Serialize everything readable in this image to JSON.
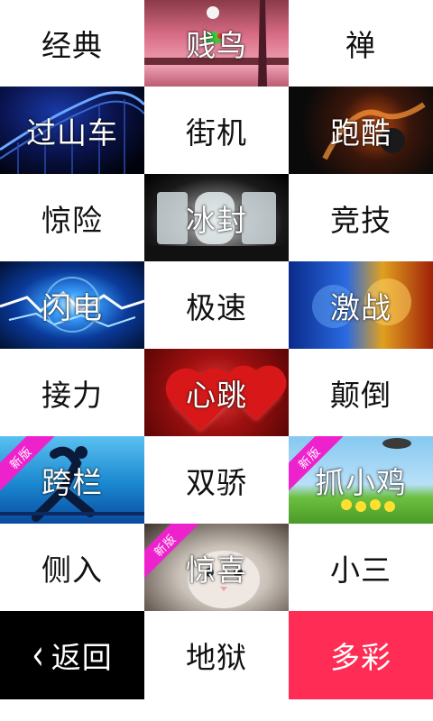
{
  "tiles": [
    {
      "label": "经典",
      "style": "white"
    },
    {
      "label": "贱鸟",
      "style": "img",
      "bg": "bird"
    },
    {
      "label": "禅",
      "style": "white"
    },
    {
      "label": "过山车",
      "style": "img",
      "bg": "coaster"
    },
    {
      "label": "街机",
      "style": "white"
    },
    {
      "label": "跑酷",
      "style": "img",
      "bg": "parkour"
    },
    {
      "label": "惊险",
      "style": "white"
    },
    {
      "label": "冰封",
      "style": "img",
      "bg": "ice"
    },
    {
      "label": "竞技",
      "style": "white"
    },
    {
      "label": "闪电",
      "style": "img",
      "bg": "lightning"
    },
    {
      "label": "极速",
      "style": "white"
    },
    {
      "label": "激战",
      "style": "img",
      "bg": "battle"
    },
    {
      "label": "接力",
      "style": "white"
    },
    {
      "label": "心跳",
      "style": "img",
      "bg": "heart"
    },
    {
      "label": "颠倒",
      "style": "white"
    },
    {
      "label": "跨栏",
      "style": "img",
      "bg": "hurdle",
      "badge": "新版"
    },
    {
      "label": "双骄",
      "style": "white"
    },
    {
      "label": "抓小鸡",
      "style": "img",
      "bg": "chick",
      "badge": "新版"
    },
    {
      "label": "侧入",
      "style": "white"
    },
    {
      "label": "惊喜",
      "style": "img",
      "bg": "kitten",
      "badge": "新版"
    },
    {
      "label": "小三",
      "style": "white"
    },
    {
      "label": "返回",
      "style": "black",
      "icon": "back-chevron-icon"
    },
    {
      "label": "地狱",
      "style": "white"
    },
    {
      "label": "多彩",
      "style": "red"
    }
  ],
  "colors": {
    "badge": "#ee22cc",
    "multicolor_tile": "#ff2d55",
    "back_tile": "#000000"
  }
}
